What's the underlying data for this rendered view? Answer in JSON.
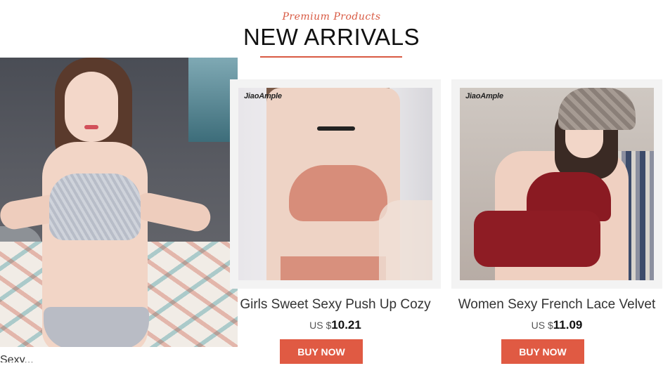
{
  "header": {
    "subtitle": "Premium Products",
    "title": "NEW ARRIVALS"
  },
  "hero": {
    "caption_fragment": "Sexy...",
    "image_alt": "Woman in grey lace bra and panty set"
  },
  "products": [
    {
      "brand": "JiaoAmple",
      "name": "Girls Sweet Sexy Push Up Cozy",
      "currency": "US $",
      "price": "10.21",
      "button": "BUY NOW"
    },
    {
      "brand": "JiaoAmple",
      "name": "Women Sexy French Lace Velvet",
      "currency": "US $",
      "price": "11.09",
      "button": "BUY NOW"
    }
  ],
  "colors": {
    "accent": "#e05a43",
    "card_background": "#f3f3f3",
    "title_text": "#111111"
  }
}
